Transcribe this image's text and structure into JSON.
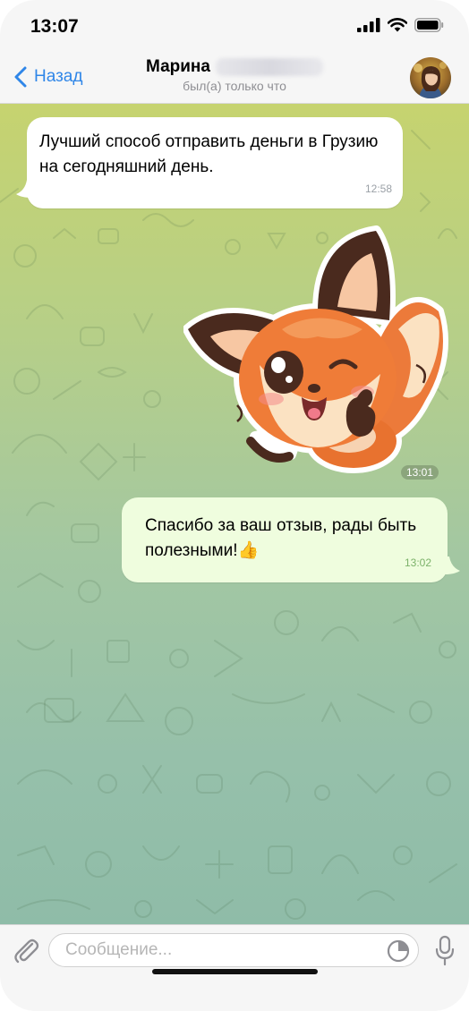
{
  "status_bar": {
    "time": "13:07"
  },
  "header": {
    "back_label": "Назад",
    "contact_name": "Марина",
    "status": "был(а) только что"
  },
  "messages": [
    {
      "direction": "incoming",
      "text": "Лучший способ отправить деньги в Грузию на сегодняшний день.",
      "time": "12:58"
    },
    {
      "direction": "incoming",
      "type": "sticker",
      "sticker": "fox-wink-thumbs-up",
      "time": "13:01"
    },
    {
      "direction": "outgoing",
      "text": "Спасибо за ваш отзыв, рады быть полезными!👍",
      "time": "13:02"
    }
  ],
  "input": {
    "placeholder": "Сообщение..."
  },
  "colors": {
    "accent": "#2f86e8",
    "incoming_bubble": "#ffffff",
    "outgoing_bubble": "#effdde",
    "outgoing_time": "#7cb26a"
  },
  "icons": {
    "back": "chevron-left-icon",
    "attach": "paperclip-icon",
    "sticker": "sticker-icon",
    "mic": "microphone-icon"
  }
}
